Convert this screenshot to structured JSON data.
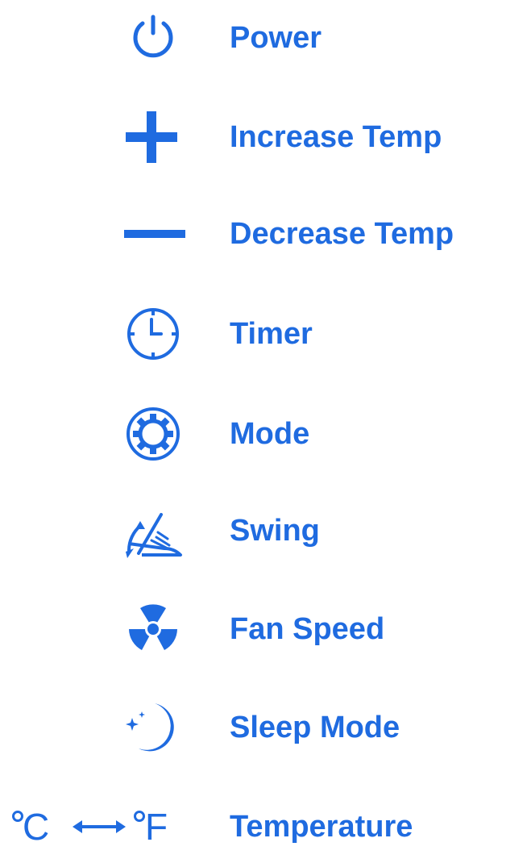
{
  "theme": {
    "accent": "#1f6be0",
    "background": "#ffffff"
  },
  "legend": {
    "items": [
      {
        "icon": "power-icon",
        "label": "Power"
      },
      {
        "icon": "plus-icon",
        "label": "Increase Temp"
      },
      {
        "icon": "minus-icon",
        "label": "Decrease Temp"
      },
      {
        "icon": "clock-icon",
        "label": "Timer"
      },
      {
        "icon": "gear-icon",
        "label": "Mode"
      },
      {
        "icon": "swing-icon",
        "label": "Swing"
      },
      {
        "icon": "fan-icon",
        "label": "Fan Speed"
      },
      {
        "icon": "moon-icon",
        "label": "Sleep Mode"
      },
      {
        "icon": "celsius-fahrenheit-icon",
        "label": "Temperature",
        "unit_left": "C",
        "unit_right": "F"
      }
    ]
  }
}
